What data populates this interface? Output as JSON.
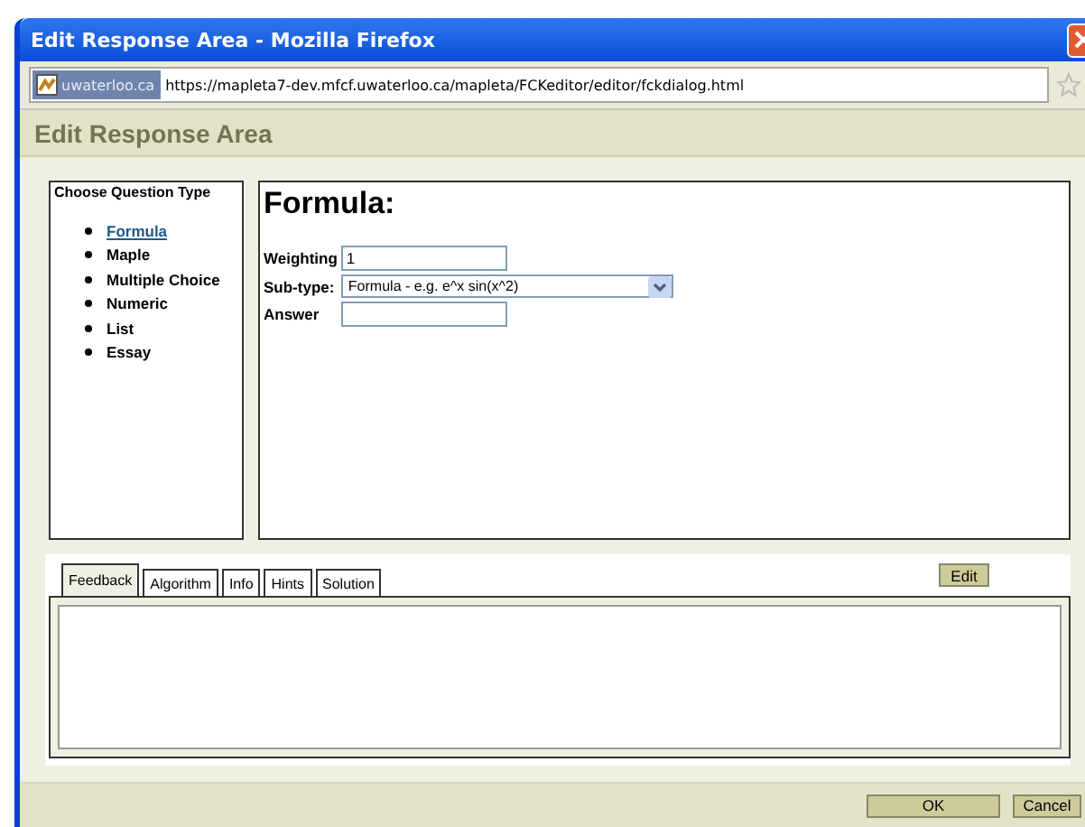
{
  "window": {
    "title": "Edit Response Area - Mozilla Firefox"
  },
  "address_bar": {
    "site": "uwaterloo.ca",
    "url": "https://mapleta7-dev.mfcf.uwaterloo.ca/mapleta/FCKeditor/editor/fckdialog.html"
  },
  "dialog": {
    "title": "Edit Response Area"
  },
  "sidebar": {
    "title": "Choose Question Type",
    "items": [
      {
        "label": "Formula",
        "selected": true
      },
      {
        "label": "Maple",
        "selected": false
      },
      {
        "label": "Multiple Choice",
        "selected": false
      },
      {
        "label": "Numeric",
        "selected": false
      },
      {
        "label": "List",
        "selected": false
      },
      {
        "label": "Essay",
        "selected": false
      }
    ]
  },
  "form": {
    "heading": "Formula:",
    "fields": [
      {
        "kind": "text",
        "label": "Weighting",
        "value": "1"
      },
      {
        "kind": "select",
        "label": "Sub-type:",
        "value": "Formula - e.g. e^x sin(x^2)"
      },
      {
        "kind": "text",
        "label": "Answer"
      }
    ]
  },
  "tabs": [
    {
      "label": "Feedback",
      "selected": true
    },
    {
      "label": "Algorithm",
      "selected": false
    },
    {
      "label": "Info",
      "selected": false
    },
    {
      "label": "Hints",
      "selected": false
    },
    {
      "label": "Solution",
      "selected": false
    }
  ],
  "edit_button": "Edit",
  "buttons": [
    "OK",
    "Cancel"
  ]
}
